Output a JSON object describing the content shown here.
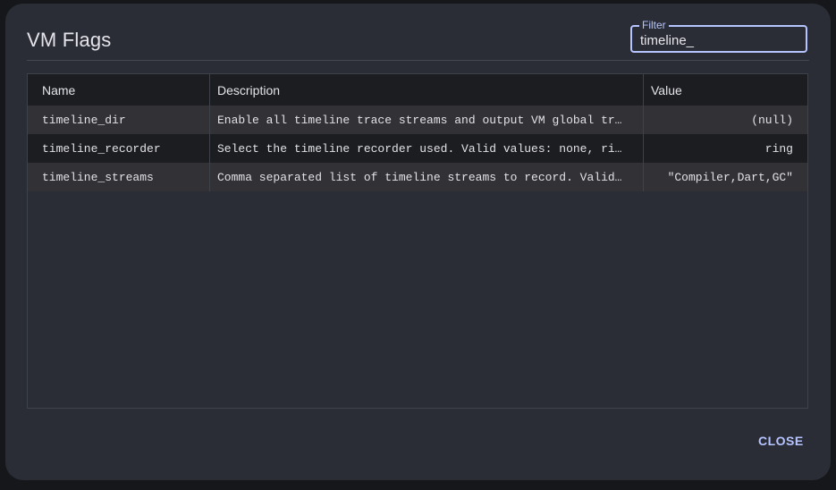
{
  "dialog": {
    "title": "VM Flags",
    "close_label": "CLOSE"
  },
  "filter": {
    "label": "Filter",
    "value": "timeline_"
  },
  "table": {
    "columns": [
      "Name",
      "Description",
      "Value"
    ],
    "rows": [
      {
        "name": "timeline_dir",
        "description": "Enable all timeline trace streams and output VM global tr…",
        "value": "(null)"
      },
      {
        "name": "timeline_recorder",
        "description": "Select the timeline recorder used. Valid values: none, ri…",
        "value": "ring"
      },
      {
        "name": "timeline_streams",
        "description": "Comma separated list of timeline streams to record. Valid…",
        "value": "\"Compiler,Dart,GC\""
      }
    ]
  },
  "colors": {
    "dialog_bg": "#2a2d35",
    "accent": "#b6c4ff",
    "header_bg": "#1c1d21",
    "row_alt_bg": "#323236"
  }
}
